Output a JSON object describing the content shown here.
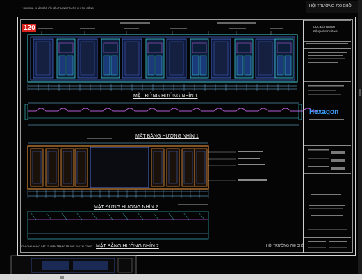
{
  "header": {
    "top_note": "*GHI CHÚ: KHẢO SÁT KỸ HIỆN TRẠNG TRƯỚC KHI THI CÔNG",
    "hall_name_top": "HỘI TRƯỜNG 700 CHỖ"
  },
  "sheet": {
    "page_number": "120",
    "bottom_note": "*GHI CHÚ: KHẢO SÁT KỸ HIỆN TRẠNG TRƯỚC KHI THI CÔNG",
    "hall_name_bottom": "HỘI TRƯỜNG 700 CHỖ"
  },
  "drawings": [
    {
      "title": "MẶT ĐỨNG HƯỚNG NHÌN 1"
    },
    {
      "title": "MẶT BẰNG HƯỚNG NHÌN 1"
    },
    {
      "title": "MẶT ĐỨNG HƯỚNG NHÌN 2"
    },
    {
      "title": "MẶT BẰNG HƯỚNG NHÌN 2"
    }
  ],
  "title_block": {
    "client": "CỤC ĐỐI NGOẠI",
    "client_sub": "BỘ QUỐC PHÒNG",
    "logo": "Hexagon"
  },
  "colors": {
    "background": "#000000",
    "frame": "#d8d8d8",
    "panel_blue": "#4a6fd8",
    "panel_cyan": "#3fd2e0",
    "wood_orange": "#d88a3a",
    "panel_magenta": "#b45ad2",
    "dimension": "#7fc9ff",
    "page_badge": "#d8231f",
    "logo": "#3aa0ff"
  }
}
